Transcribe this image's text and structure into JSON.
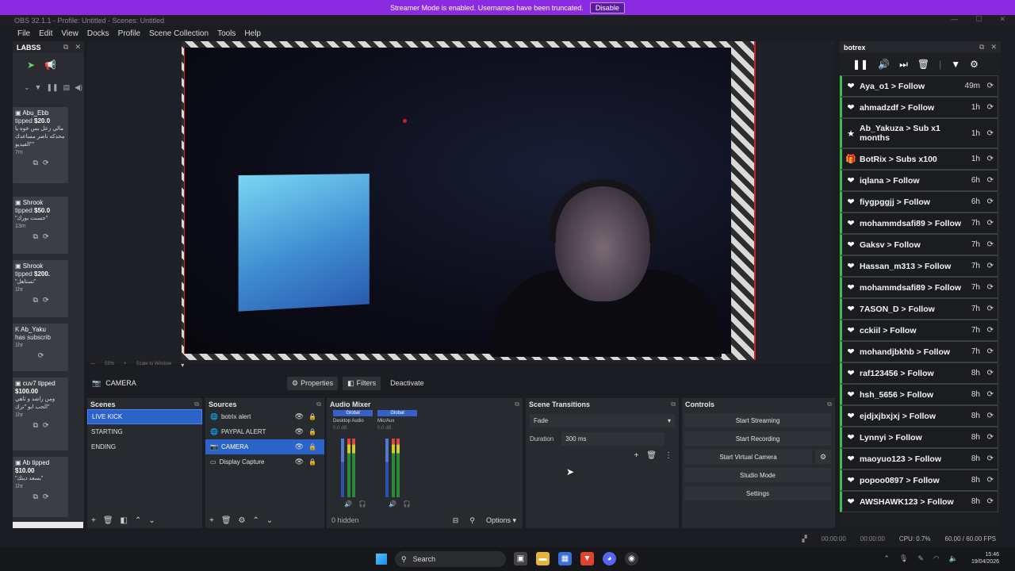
{
  "banner": {
    "text": "Streamer Mode is enabled. Usernames have been truncated.",
    "button": "Disable"
  },
  "window": {
    "title": "OBS 32.1.1 - Profile: Untitled - Scenes: Untitled"
  },
  "menu": [
    "File",
    "Edit",
    "View",
    "Docks",
    "Profile",
    "Scene Collection",
    "Tools",
    "Help"
  ],
  "labs": {
    "title": "LABSS",
    "tips": [
      {
        "who": "Abu_Ebb",
        "action": "tipped",
        "amount": "$20.0",
        "msg": "مالي زعل بس خوه يا محدكه ناصر مساعدك \"الفيديو\"",
        "age": "7m"
      },
      {
        "who": "Shrook",
        "action": "tipped",
        "amount": "$50.0",
        "msg": "\"حسنت بورك\"",
        "age": "13m"
      },
      {
        "who": "Shrook",
        "action": "tipped",
        "amount": "$200.",
        "msg": "\"تستاهل\"",
        "age": "1hr"
      },
      {
        "who": "Ab_Yaku",
        "action": "has subscrib",
        "amount": "",
        "msg": "",
        "age": "1hr"
      },
      {
        "who": "cuv7 tipped",
        "action": "",
        "amount": "$100.00",
        "msg": "ومن راشد و تاهي الحب ابو \"ترك\"",
        "age": "1hr"
      },
      {
        "who": "Ab tipped",
        "action": "",
        "amount": "$10.00",
        "msg": "\"يسعد دينك\"",
        "age": "1hr"
      }
    ]
  },
  "preview": {
    "zoom": "55%",
    "scale_label": "Scale to Window"
  },
  "context": {
    "source": "CAMERA",
    "properties": "Properties",
    "filters": "Filters",
    "deactivate": "Deactivate"
  },
  "scenes": {
    "title": "Scenes",
    "items": [
      "LIVE KICK",
      "STARTING",
      "ENDING"
    ]
  },
  "sources": {
    "title": "Sources",
    "items": [
      "botrix alert",
      "PAYPAL ALERT",
      "CAMERA",
      "Display Capture"
    ]
  },
  "mixer": {
    "title": "Audio Mixer",
    "channels": [
      {
        "global": "Global",
        "name": "Desktop Audio",
        "db": "0.0 dB"
      },
      {
        "global": "Global",
        "name": "Mic/Aux",
        "db": "0.0 dB"
      }
    ],
    "hidden": "0 hidden",
    "options": "Options"
  },
  "transitions": {
    "title": "Scene Transitions",
    "type": "Fade",
    "duration_label": "Duration",
    "duration": "300 ms"
  },
  "controls": {
    "title": "Controls",
    "buttons": [
      "Start Streaming",
      "Start Recording",
      "Start Virtual Camera",
      "Studio Mode",
      "Settings"
    ]
  },
  "botrix": {
    "title": "botrex",
    "events": [
      {
        "icon": "heart",
        "text": "Aya_o1 > Follow",
        "time": "49m"
      },
      {
        "icon": "heart",
        "text": "ahmadzdf > Follow",
        "time": "1h"
      },
      {
        "icon": "star",
        "text": "Ab_Yakuza > Sub x1 months",
        "time": "1h"
      },
      {
        "icon": "gift",
        "text": "BotRix > Subs x100",
        "time": "1h"
      },
      {
        "icon": "heart",
        "text": "iqlana > Follow",
        "time": "6h"
      },
      {
        "icon": "heart",
        "text": "fiygpggjj > Follow",
        "time": "6h"
      },
      {
        "icon": "heart",
        "text": "mohammdsafi89 > Follow",
        "time": "7h"
      },
      {
        "icon": "heart",
        "text": "Gaksv > Follow",
        "time": "7h"
      },
      {
        "icon": "heart",
        "text": "Hassan_m313 > Follow",
        "time": "7h"
      },
      {
        "icon": "heart",
        "text": "mohammdsafi89 > Follow",
        "time": "7h"
      },
      {
        "icon": "heart",
        "text": "7ASON_D > Follow",
        "time": "7h"
      },
      {
        "icon": "heart",
        "text": "cckiil > Follow",
        "time": "7h"
      },
      {
        "icon": "heart",
        "text": "mohandjbkhb > Follow",
        "time": "7h"
      },
      {
        "icon": "heart",
        "text": "raf123456 > Follow",
        "time": "8h"
      },
      {
        "icon": "heart",
        "text": "hsh_5656 > Follow",
        "time": "8h"
      },
      {
        "icon": "heart",
        "text": "ejdjxjbxjxj > Follow",
        "time": "8h"
      },
      {
        "icon": "heart",
        "text": "Lynnyi > Follow",
        "time": "8h"
      },
      {
        "icon": "heart",
        "text": "maoyuo123 > Follow",
        "time": "8h"
      },
      {
        "icon": "heart",
        "text": "popoo0897 > Follow",
        "time": "8h"
      },
      {
        "icon": "heart",
        "text": "AWSHAWK123 > Follow",
        "time": "8h"
      }
    ]
  },
  "status": {
    "stream_time": "00:00:00",
    "rec_time": "00:00:00",
    "cpu": "CPU: 0.7%",
    "fps": "60.00 / 60.00 FPS"
  },
  "taskbar": {
    "search": "Search",
    "time": "15:46",
    "date": "19/04/2026"
  },
  "colors": {
    "accent": "#2c63c8",
    "banner": "#8a2be2",
    "event_border": "#3fbf4f"
  }
}
